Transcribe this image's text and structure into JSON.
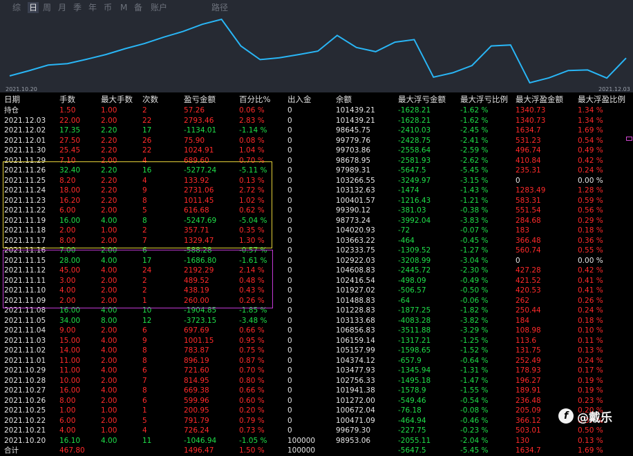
{
  "tabs": [
    "综",
    "日",
    "周",
    "月",
    "季",
    "年",
    "币",
    "M",
    "备",
    "账户",
    "路径"
  ],
  "active_tab": 1,
  "chart": {
    "start_label": "2021.10.20",
    "end_label": "2021.12.03",
    "line_color": "#29b6f6"
  },
  "columns": [
    "日期",
    "手数",
    "最大手数",
    "次数",
    "盈亏金额",
    "百分比%",
    "出入金",
    "余额",
    "最大浮亏金额",
    "最大浮亏比例",
    "最大浮盈金额",
    "最大浮盈比例"
  ],
  "rows": [
    [
      "持仓",
      "1.50",
      "1.00",
      "2",
      "57.26",
      "0.06 %",
      "0",
      "101439.21",
      "-1628.21",
      "-1.62 %",
      "1340.73",
      "1.34 %"
    ],
    [
      "2021.12.03",
      "22.00",
      "2.00",
      "22",
      "2793.46",
      "2.83 %",
      "0",
      "101439.21",
      "-1628.21",
      "-1.62 %",
      "1340.73",
      "1.34 %"
    ],
    [
      "2021.12.02",
      "17.35",
      "2.20",
      "17",
      "-1134.01",
      "-1.14 %",
      "0",
      "98645.75",
      "-2410.03",
      "-2.45 %",
      "1634.7",
      "1.69 %"
    ],
    [
      "2021.12.01",
      "27.50",
      "2.20",
      "26",
      "75.90",
      "0.08 %",
      "0",
      "99779.76",
      "-2428.75",
      "-2.41 %",
      "531.23",
      "0.54 %"
    ],
    [
      "2021.11.30",
      "25.45",
      "2.20",
      "22",
      "1024.91",
      "1.04 %",
      "0",
      "99703.86",
      "-2558.64",
      "-2.59 %",
      "496.74",
      "0.49 %"
    ],
    [
      "2021.11.29",
      "7.10",
      "2.00",
      "4",
      "689.60",
      "0.70 %",
      "0",
      "98678.95",
      "-2581.93",
      "-2.62 %",
      "410.84",
      "0.42 %"
    ],
    [
      "2021.11.26",
      "32.40",
      "2.20",
      "16",
      "-5277.24",
      "-5.11 %",
      "0",
      "97989.31",
      "-5647.5",
      "-5.45 %",
      "235.31",
      "0.24 %"
    ],
    [
      "2021.11.25",
      "8.20",
      "2.20",
      "4",
      "133.92",
      "0.13 %",
      "0",
      "103266.55",
      "-3249.97",
      "-3.15 %",
      "0",
      "0.00 %"
    ],
    [
      "2021.11.24",
      "18.00",
      "2.20",
      "9",
      "2731.06",
      "2.72 %",
      "0",
      "103132.63",
      "-1474",
      "-1.43 %",
      "1283.49",
      "1.28 %"
    ],
    [
      "2021.11.23",
      "16.20",
      "2.20",
      "8",
      "1011.45",
      "1.02 %",
      "0",
      "100401.57",
      "-1216.43",
      "-1.21 %",
      "583.31",
      "0.59 %"
    ],
    [
      "2021.11.22",
      "6.00",
      "2.00",
      "5",
      "616.68",
      "0.62 %",
      "0",
      "99390.12",
      "-381.03",
      "-0.38 %",
      "551.54",
      "0.56 %"
    ],
    [
      "2021.11.19",
      "16.00",
      "4.00",
      "8",
      "-5247.69",
      "-5.04 %",
      "0",
      "98773.24",
      "-3992.04",
      "-3.83 %",
      "284.68",
      "0.29 %"
    ],
    [
      "2021.11.18",
      "2.00",
      "1.00",
      "2",
      "357.71",
      "0.35 %",
      "0",
      "104020.93",
      "-72",
      "-0.07 %",
      "183",
      "0.18 %"
    ],
    [
      "2021.11.17",
      "8.00",
      "2.00",
      "7",
      "1329.47",
      "1.30 %",
      "0",
      "103663.22",
      "-464",
      "-0.45 %",
      "366.48",
      "0.36 %"
    ],
    [
      "2021.11.16",
      "7.00",
      "2.00",
      "6",
      "-588.28",
      "-0.57 %",
      "0",
      "102333.75",
      "-1309.52",
      "-1.27 %",
      "560.74",
      "0.55 %"
    ],
    [
      "2021.11.15",
      "28.00",
      "4.00",
      "17",
      "-1686.80",
      "-1.61 %",
      "0",
      "102922.03",
      "-3208.99",
      "-3.04 %",
      "0",
      "0.00 %"
    ],
    [
      "2021.11.12",
      "45.00",
      "4.00",
      "24",
      "2192.29",
      "2.14 %",
      "0",
      "104608.83",
      "-2445.72",
      "-2.30 %",
      "427.28",
      "0.42 %"
    ],
    [
      "2021.11.11",
      "3.00",
      "2.00",
      "2",
      "489.52",
      "0.48 %",
      "0",
      "102416.54",
      "-498.09",
      "-0.49 %",
      "421.52",
      "0.41 %"
    ],
    [
      "2021.11.10",
      "4.00",
      "2.00",
      "2",
      "438.19",
      "0.43 %",
      "0",
      "101927.02",
      "-506.57",
      "-0.50 %",
      "420.53",
      "0.41 %"
    ],
    [
      "2021.11.09",
      "2.00",
      "2.00",
      "1",
      "260.00",
      "0.26 %",
      "0",
      "101488.83",
      "-64",
      "-0.06 %",
      "262",
      "0.26 %"
    ],
    [
      "2021.11.08",
      "16.00",
      "4.00",
      "10",
      "-1904.85",
      "-1.85 %",
      "0",
      "101228.83",
      "-1877.25",
      "-1.82 %",
      "250.44",
      "0.24 %"
    ],
    [
      "2021.11.05",
      "34.00",
      "8.00",
      "12",
      "-3723.15",
      "-3.48 %",
      "0",
      "103133.68",
      "-4083.28",
      "-3.82 %",
      "184",
      "0.18 %"
    ],
    [
      "2021.11.04",
      "9.00",
      "2.00",
      "6",
      "697.69",
      "0.66 %",
      "0",
      "106856.83",
      "-3511.88",
      "-3.29 %",
      "108.98",
      "0.10 %"
    ],
    [
      "2021.11.03",
      "15.00",
      "4.00",
      "9",
      "1001.15",
      "0.95 %",
      "0",
      "106159.14",
      "-1317.21",
      "-1.25 %",
      "113.6",
      "0.11 %"
    ],
    [
      "2021.11.02",
      "14.00",
      "4.00",
      "8",
      "783.87",
      "0.75 %",
      "0",
      "105157.99",
      "-1598.65",
      "-1.52 %",
      "131.75",
      "0.13 %"
    ],
    [
      "2021.11.01",
      "11.00",
      "2.00",
      "8",
      "896.19",
      "0.87 %",
      "0",
      "104374.12",
      "-657.9",
      "-0.64 %",
      "252.49",
      "0.24 %"
    ],
    [
      "2021.10.29",
      "11.00",
      "4.00",
      "6",
      "721.60",
      "0.70 %",
      "0",
      "103477.93",
      "-1345.94",
      "-1.31 %",
      "178.93",
      "0.17 %"
    ],
    [
      "2021.10.28",
      "10.00",
      "2.00",
      "7",
      "814.95",
      "0.80 %",
      "0",
      "102756.33",
      "-1495.18",
      "-1.47 %",
      "196.27",
      "0.19 %"
    ],
    [
      "2021.10.27",
      "16.00",
      "4.00",
      "8",
      "669.38",
      "0.66 %",
      "0",
      "101941.38",
      "-1578.9",
      "-1.55 %",
      "189.91",
      "0.19 %"
    ],
    [
      "2021.10.26",
      "8.00",
      "2.00",
      "6",
      "599.96",
      "0.60 %",
      "0",
      "101272.00",
      "-549.46",
      "-0.54 %",
      "236.48",
      "0.23 %"
    ],
    [
      "2021.10.25",
      "1.00",
      "1.00",
      "1",
      "200.95",
      "0.20 %",
      "0",
      "100672.04",
      "-76.18",
      "-0.08 %",
      "205.09",
      "0.20 %"
    ],
    [
      "2021.10.22",
      "6.00",
      "2.00",
      "5",
      "791.79",
      "0.79 %",
      "0",
      "100471.09",
      "-464.94",
      "-0.46 %",
      "366.12",
      "0.37 %"
    ],
    [
      "2021.10.21",
      "4.00",
      "1.00",
      "4",
      "726.24",
      "0.73 %",
      "0",
      "99679.30",
      "-227.75",
      "-0.23 %",
      "503.01",
      "0.50 %"
    ],
    [
      "2021.10.20",
      "16.10",
      "4.00",
      "11",
      "-1046.94",
      "-1.05 %",
      "100000",
      "98953.06",
      "-2055.11",
      "-2.04 %",
      "130",
      "0.13 %"
    ],
    [
      "合计",
      "467.80",
      "",
      "",
      "1496.47",
      "1.50 %",
      "100000",
      "",
      "-5647.5",
      "-5.45 %",
      "1634.7",
      "1.69 %"
    ]
  ],
  "watermark": {
    "logo": "f",
    "text": "@戴乐"
  }
}
